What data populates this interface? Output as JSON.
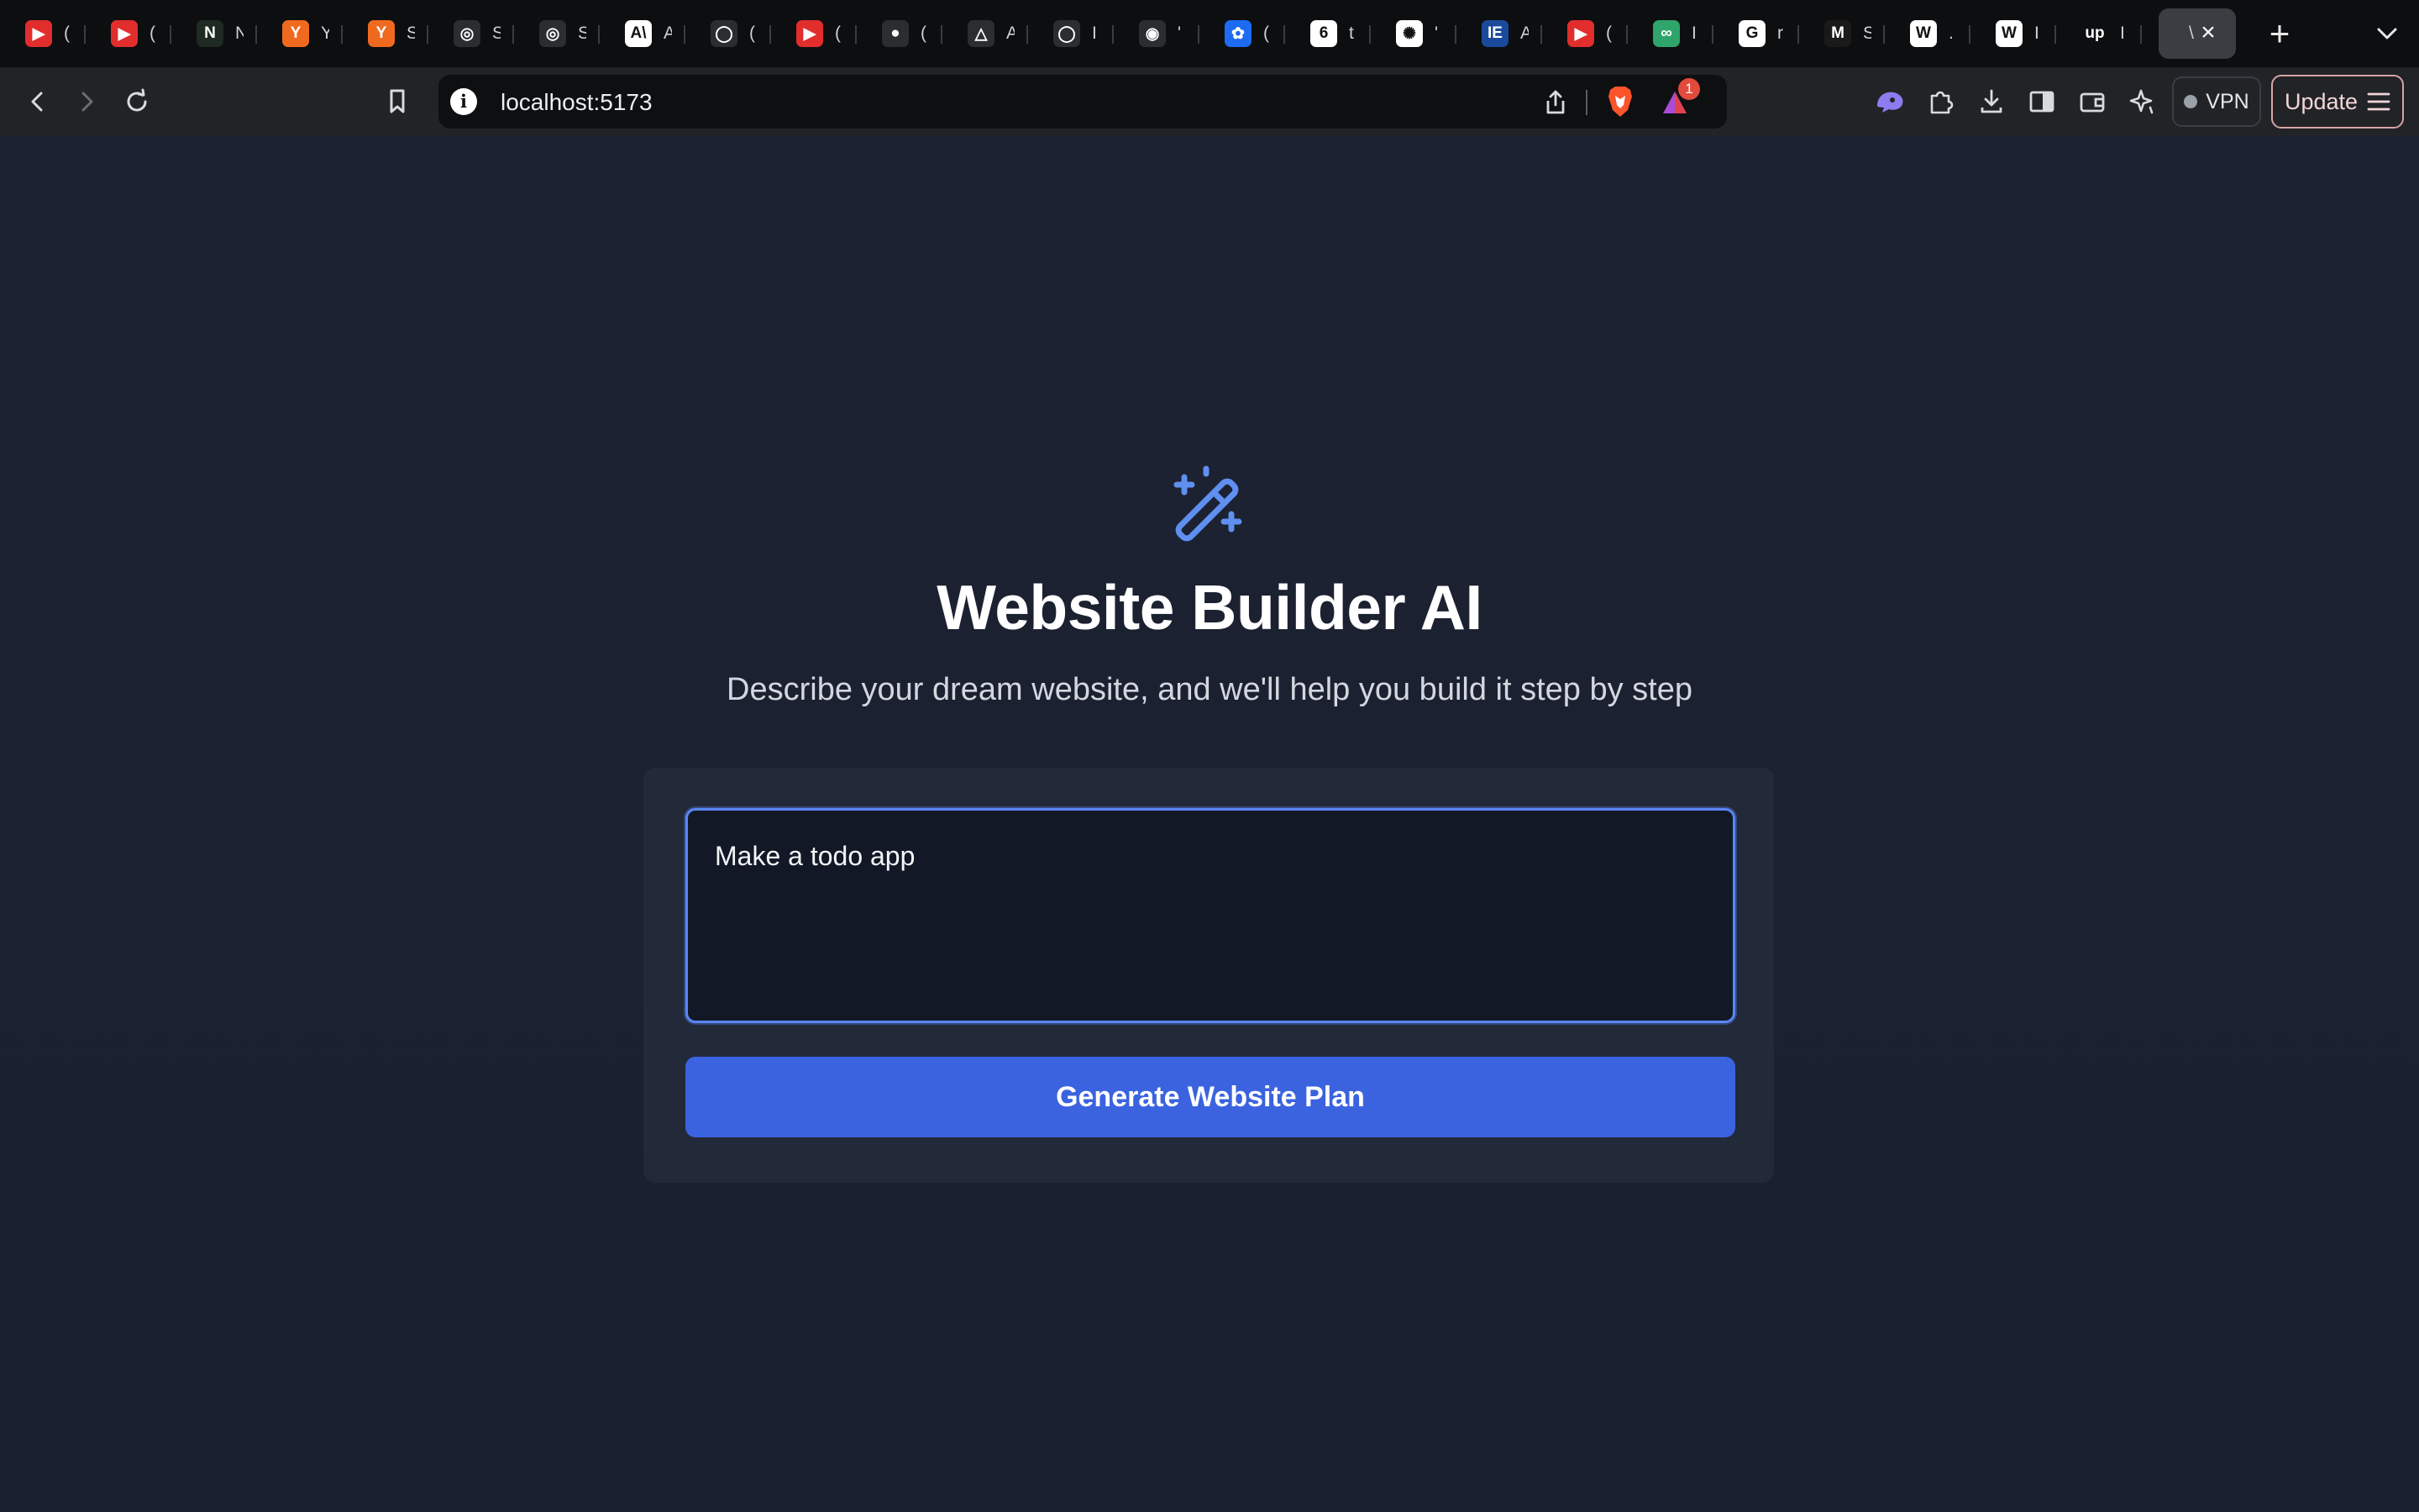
{
  "browser": {
    "tabs": [
      {
        "icon": "youtube-icon",
        "color": "#e22d2d",
        "glyph": "▶",
        "text": "("
      },
      {
        "icon": "youtube-icon",
        "color": "#e22d2d",
        "glyph": "▶",
        "text": "("
      },
      {
        "icon": "app-icon",
        "color": "#1f2a22",
        "glyph": "N",
        "text": "N"
      },
      {
        "icon": "ycombinator-icon",
        "color": "#ef6a1f",
        "glyph": "Y",
        "text": "Y"
      },
      {
        "icon": "ycombinator-icon",
        "color": "#ef6a1f",
        "glyph": "Y",
        "text": "S"
      },
      {
        "icon": "openai-icon",
        "color": "#2b2d30",
        "glyph": "◎",
        "text": "S"
      },
      {
        "icon": "openai-icon",
        "color": "#2b2d30",
        "glyph": "◎",
        "text": "S"
      },
      {
        "icon": "anthropic-icon",
        "color": "#ffffff",
        "glyph": "A\\",
        "text": "A"
      },
      {
        "icon": "github-icon",
        "color": "#2b2d30",
        "glyph": "◯",
        "text": "("
      },
      {
        "icon": "youtube-icon",
        "color": "#e22d2d",
        "glyph": "▶",
        "text": "("
      },
      {
        "icon": "github-icon",
        "color": "#2b2d30",
        "glyph": "●",
        "text": "("
      },
      {
        "icon": "drive-icon",
        "color": "#2b2d30",
        "glyph": "△",
        "text": "A"
      },
      {
        "icon": "github-icon",
        "color": "#2b2d30",
        "glyph": "◯",
        "text": "I"
      },
      {
        "icon": "settings-icon",
        "color": "#2b2d30",
        "glyph": "◉",
        "text": "'"
      },
      {
        "icon": "bluesky-icon",
        "color": "#1d6bf0",
        "glyph": "✿",
        "text": "("
      },
      {
        "icon": "app-icon",
        "color": "#ffffff",
        "glyph": "6",
        "text": "t"
      },
      {
        "icon": "openai-icon",
        "color": "#ffffff",
        "glyph": "✺",
        "text": "'"
      },
      {
        "icon": "ieee-icon",
        "color": "#1b4a9c",
        "glyph": "IE",
        "text": "A"
      },
      {
        "icon": "youtube-icon",
        "color": "#e22d2d",
        "glyph": "▶",
        "text": "("
      },
      {
        "icon": "app-icon",
        "color": "#2fa46b",
        "glyph": "∞",
        "text": "I"
      },
      {
        "icon": "google-icon",
        "color": "#ffffff",
        "glyph": "G",
        "text": "r"
      },
      {
        "icon": "gmail-icon",
        "color": "#1a1a1a",
        "glyph": "M",
        "text": "S"
      },
      {
        "icon": "wikipedia-icon",
        "color": "#ffffff",
        "glyph": "W",
        "text": "."
      },
      {
        "icon": "wikipedia-icon",
        "color": "#ffffff",
        "glyph": "W",
        "text": "I"
      },
      {
        "icon": "upwork-icon",
        "color": "#0d0e10",
        "glyph": "up",
        "text": "I"
      }
    ],
    "active_tab": {
      "text": "\\"
    },
    "url": "localhost:5173",
    "notification_count": "1",
    "vpn_label": "VPN",
    "update_label": "Update"
  },
  "page": {
    "title": "Website Builder AI",
    "subtitle": "Describe your dream website, and we'll help you build it step by step",
    "prompt_value": "Make a todo app",
    "button_label": "Generate Website Plan",
    "accent": "#3b63e0",
    "icon": "magic-wand-icon"
  }
}
